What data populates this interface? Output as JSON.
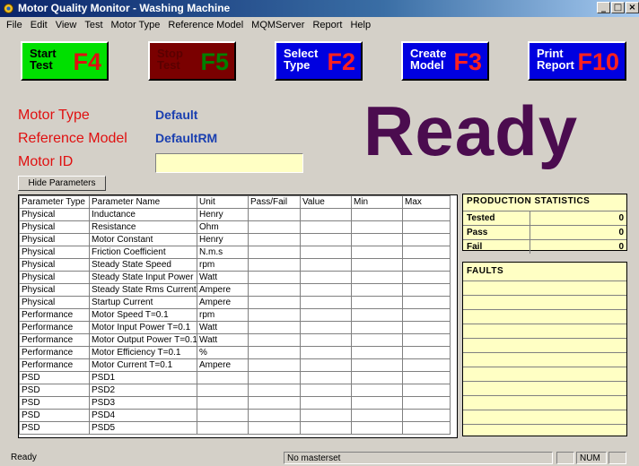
{
  "window": {
    "title": "Motor Quality Monitor - Washing Machine",
    "controls": [
      "_",
      "□",
      "×"
    ]
  },
  "menu": [
    "File",
    "Edit",
    "View",
    "Test",
    "Motor Type",
    "Reference Model",
    "MQMServer",
    "Report",
    "Help"
  ],
  "toolbar": [
    {
      "label": "Start\nTest",
      "key": "F4",
      "bg": "#00e000",
      "fg": "#000000",
      "key_color": "#e01010"
    },
    {
      "label": "Stop\nTest",
      "key": "F5",
      "bg": "#7a0000",
      "fg": "#5a0000",
      "key_color": "#008000"
    },
    {
      "label": "Select\nType",
      "key": "F2",
      "bg": "#0000e0",
      "fg": "#ffffff",
      "key_color": "#ff2020"
    },
    {
      "label": "Create\nModel",
      "key": "F3",
      "bg": "#0000e0",
      "fg": "#ffffff",
      "key_color": "#ff2020"
    },
    {
      "label": "Print\nReport",
      "key": "F10",
      "bg": "#0000e0",
      "fg": "#ffffff",
      "key_color": "#ff2020"
    }
  ],
  "info": {
    "motor_type_label": "Motor Type",
    "motor_type_value": "Default",
    "reference_model_label": "Reference Model",
    "reference_model_value": "DefaultRM",
    "motor_id_label": "Motor ID",
    "motor_id_value": ""
  },
  "status_big": "Ready",
  "hide_params_label": "Hide Parameters",
  "table": {
    "headers": [
      "Parameter Type",
      "Parameter Name",
      "Unit",
      "Pass/Fail",
      "Value",
      "Min",
      "Max"
    ],
    "rows": [
      [
        "Physical",
        "Inductance",
        "Henry",
        "",
        "",
        "",
        ""
      ],
      [
        "Physical",
        "Resistance",
        "Ohm",
        "",
        "",
        "",
        ""
      ],
      [
        "Physical",
        "Motor Constant",
        "Henry",
        "",
        "",
        "",
        ""
      ],
      [
        "Physical",
        "Friction Coefficient",
        "N.m.s",
        "",
        "",
        "",
        ""
      ],
      [
        "Physical",
        "Steady State Speed",
        "rpm",
        "",
        "",
        "",
        ""
      ],
      [
        "Physical",
        "Steady State Input Power",
        "Watt",
        "",
        "",
        "",
        ""
      ],
      [
        "Physical",
        "Steady State Rms Current",
        "Ampere",
        "",
        "",
        "",
        ""
      ],
      [
        "Physical",
        "Startup Current",
        "Ampere",
        "",
        "",
        "",
        ""
      ],
      [
        "Performance",
        "Motor Speed T=0.1",
        "rpm",
        "",
        "",
        "",
        ""
      ],
      [
        "Performance",
        "Motor Input Power T=0.1",
        "Watt",
        "",
        "",
        "",
        ""
      ],
      [
        "Performance",
        "Motor Output Power T=0.1",
        "Watt",
        "",
        "",
        "",
        ""
      ],
      [
        "Performance",
        "Motor Efficiency T=0.1",
        "%",
        "",
        "",
        "",
        ""
      ],
      [
        "Performance",
        "Motor Current T=0.1",
        "Ampere",
        "",
        "",
        "",
        ""
      ],
      [
        "PSD",
        "PSD1",
        "",
        "",
        "",
        "",
        ""
      ],
      [
        "PSD",
        "PSD2",
        "",
        "",
        "",
        "",
        ""
      ],
      [
        "PSD",
        "PSD3",
        "",
        "",
        "",
        "",
        ""
      ],
      [
        "PSD",
        "PSD4",
        "",
        "",
        "",
        "",
        ""
      ],
      [
        "PSD",
        "PSD5",
        "",
        "",
        "",
        "",
        ""
      ]
    ]
  },
  "production_stats": {
    "title": "PRODUCTION STATISTICS",
    "rows": [
      {
        "label": "Tested",
        "value": "0"
      },
      {
        "label": "Pass",
        "value": "0"
      },
      {
        "label": "Fail",
        "value": "0"
      }
    ]
  },
  "faults": {
    "title": "FAULTS",
    "lines": 11
  },
  "statusbar": {
    "left": "Ready",
    "middle": "No masterset",
    "num": "NUM"
  }
}
